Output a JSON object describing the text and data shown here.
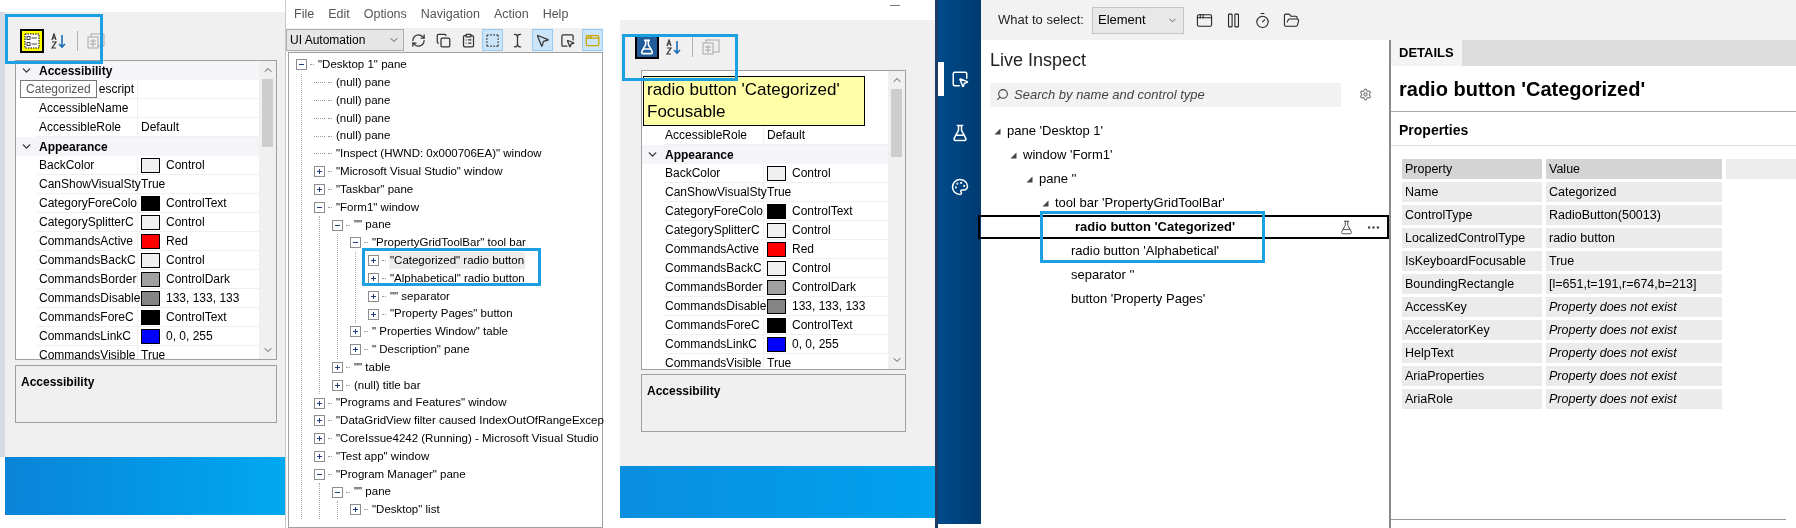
{
  "left_inspector": {
    "toolbar": [
      {
        "kind": "categorized",
        "selected": true,
        "disabled": false
      },
      {
        "kind": "alphabetical",
        "selected": false,
        "disabled": false
      },
      {
        "kind": "pages",
        "selected": false,
        "disabled": true
      }
    ],
    "grid": {
      "categories": [
        {
          "title": "Accessibility",
          "expanded": true,
          "rows": [
            {
              "name": "escript",
              "tooltip": "Categorized"
            },
            {
              "name": "AccessibleName"
            },
            {
              "name": "AccessibleRole",
              "value": "Default"
            }
          ]
        },
        {
          "title": "Appearance",
          "expanded": true,
          "rows": [
            {
              "name": "BackColor",
              "value": "Control",
              "color": "#f0f0f0"
            },
            {
              "name": "CanShowVisualSty",
              "value": "True"
            },
            {
              "name": "CategoryForeColo",
              "value": "ControlText",
              "color": "#000000"
            },
            {
              "name": "CategorySplitterC",
              "value": "Control",
              "color": "#f0f0f0"
            },
            {
              "name": "CommandsActive",
              "value": "Red",
              "color": "#ff0000"
            },
            {
              "name": "CommandsBackC",
              "value": "Control",
              "color": "#f0f0f0"
            },
            {
              "name": "CommandsBorder",
              "value": "ControlDark",
              "color": "#a0a0a0"
            },
            {
              "name": "CommandsDisable",
              "value": "133, 133, 133",
              "color": "#858585"
            },
            {
              "name": "CommandsForeC",
              "value": "ControlText",
              "color": "#000000"
            },
            {
              "name": "CommandsLinkC",
              "value": "0, 0, 255",
              "color": "#0000ff"
            },
            {
              "name": "CommandsVisible",
              "value": "True"
            }
          ]
        }
      ]
    },
    "description_title": "Accessibility"
  },
  "tree_window": {
    "menu": [
      "File",
      "Edit",
      "Options",
      "Navigation",
      "Action",
      "Help"
    ],
    "provider": "UI Automation",
    "toolbar": [
      {
        "kind": "refresh",
        "selected": false
      },
      {
        "kind": "copy",
        "selected": false
      },
      {
        "kind": "properties",
        "selected": false
      },
      {
        "kind": "rectangle",
        "selected": true
      },
      {
        "kind": "text",
        "selected": false
      },
      {
        "kind": "pointer",
        "selected": true
      },
      {
        "kind": "hover",
        "selected": false
      },
      {
        "kind": "highlight",
        "selected": true
      }
    ],
    "tree": [
      {
        "label": "\"Desktop 1\" pane",
        "expanded": true,
        "selected": false,
        "children": [
          {
            "label": "(null) pane",
            "selected": false
          },
          {
            "label": "(null) pane",
            "selected": false
          },
          {
            "label": "(null) pane",
            "selected": false
          },
          {
            "label": "(null) pane",
            "selected": false
          },
          {
            "label": "\"Inspect  (HWND: 0x000706EA)\" window",
            "selected": false
          },
          {
            "label": "\"Microsoft Visual Studio\" window",
            "expanded": false,
            "selected": false
          },
          {
            "label": "\"Taskbar\" pane",
            "expanded": false,
            "selected": false
          },
          {
            "label": "\"Form1\" window",
            "expanded": true,
            "selected": false,
            "children": [
              {
                "label": "\"\" pane",
                "expanded": true,
                "selected": false,
                "children": [
                  {
                    "label": "\"PropertyGridToolBar\" tool bar",
                    "expanded": true,
                    "selected": false,
                    "children": [
                      {
                        "label": "\"Categorized\" radio button",
                        "expanded": false,
                        "selected": true
                      },
                      {
                        "label": "\"Alphabetical\" radio button",
                        "expanded": false,
                        "selected": false
                      },
                      {
                        "label": "\"\" separator",
                        "expanded": false,
                        "selected": false
                      },
                      {
                        "label": "\"Property Pages\" button",
                        "expanded": false,
                        "selected": false
                      }
                    ]
                  },
                  {
                    "label": "\" Properties Window\" table",
                    "expanded": false,
                    "selected": false
                  },
                  {
                    "label": "\" Description\" pane",
                    "expanded": false,
                    "selected": false
                  }
                ]
              },
              {
                "label": "\"\" table",
                "expanded": false,
                "selected": false
              },
              {
                "label": "(null) title bar",
                "expanded": false,
                "selected": false
              }
            ]
          },
          {
            "label": "\"Programs and Features\" window",
            "expanded": false,
            "selected": false
          },
          {
            "label": "\"DataGridView filter caused IndexOutOfRangeExcep",
            "expanded": false,
            "selected": false
          },
          {
            "label": "\"CoreIssue4242 (Running) - Microsoft Visual Studio",
            "expanded": false,
            "selected": false
          },
          {
            "label": "\"Test app\" window",
            "expanded": false,
            "selected": false
          },
          {
            "label": "\"Program Manager\" pane",
            "expanded": true,
            "selected": false,
            "children": [
              {
                "label": "\"\" pane",
                "expanded": true,
                "selected": false,
                "children": [
                  {
                    "label": "\"Desktop\" list",
                    "expanded": false,
                    "selected": false
                  }
                ]
              }
            ]
          }
        ]
      }
    ]
  },
  "right_inspector": {
    "toolbar": [
      {
        "kind": "flask-marker",
        "selected": true,
        "disabled": false
      },
      {
        "kind": "alphabetical",
        "selected": false,
        "disabled": false
      },
      {
        "kind": "pages",
        "selected": false,
        "disabled": true
      }
    ],
    "tooltip": [
      "radio button 'Categorized'",
      "Focusable"
    ],
    "grid": {
      "categories": [
        {
          "rows": [
            {
              "name": "AccessibleRole",
              "value": "Default"
            }
          ]
        },
        {
          "title": "Appearance",
          "expanded": true,
          "rows": [
            {
              "name": "BackColor",
              "value": "Control",
              "color": "#f0f0f0"
            },
            {
              "name": "CanShowVisualSty",
              "value": "True"
            },
            {
              "name": "CategoryForeColo",
              "value": "ControlText",
              "color": "#000000"
            },
            {
              "name": "CategorySplitterC",
              "value": "Control",
              "color": "#f0f0f0"
            },
            {
              "name": "CommandsActive",
              "value": "Red",
              "color": "#ff0000"
            },
            {
              "name": "CommandsBackC",
              "value": "Control",
              "color": "#f0f0f0"
            },
            {
              "name": "CommandsBorder",
              "value": "ControlDark",
              "color": "#a0a0a0"
            },
            {
              "name": "CommandsDisable",
              "value": "133, 133, 133",
              "color": "#858585"
            },
            {
              "name": "CommandsForeC",
              "value": "ControlText",
              "color": "#000000"
            },
            {
              "name": "CommandsLinkC",
              "value": "0, 0, 255",
              "color": "#0000ff"
            },
            {
              "name": "CommandsVisible",
              "value": "True"
            }
          ]
        }
      ]
    },
    "description_title": "Accessibility"
  },
  "insights": {
    "nav": [
      {
        "kind": "inspect",
        "selected": true
      },
      {
        "kind": "test",
        "selected": false
      },
      {
        "kind": "color",
        "selected": false
      }
    ],
    "select_label": "What to select:",
    "select_value": "Element",
    "tools": [
      {
        "kind": "window"
      },
      {
        "kind": "pause"
      },
      {
        "kind": "timer"
      },
      {
        "kind": "folder"
      }
    ],
    "live_title": "Live Inspect",
    "search": {
      "placeholder": "Search by name and control type"
    },
    "tree": [
      {
        "label": "pane 'Desktop 1'",
        "expanded": true,
        "selected": false,
        "children": [
          {
            "label": "window 'Form1'",
            "expanded": true,
            "selected": false,
            "children": [
              {
                "label": "pane ''",
                "expanded": true,
                "selected": false,
                "children": [
                  {
                    "label": "tool bar 'PropertyGridToolBar'",
                    "expanded": true,
                    "selected": false,
                    "children": [
                      {
                        "label": "radio button 'Categorized'",
                        "selected": true
                      },
                      {
                        "label": "radio button 'Alphabetical'",
                        "selected": false
                      },
                      {
                        "label": "separator ''",
                        "selected": false
                      },
                      {
                        "label": "button 'Property Pages'",
                        "selected": false
                      }
                    ]
                  }
                ]
              }
            ]
          }
        ]
      }
    ],
    "details_tab": "DETAILS",
    "details_title": "radio button 'Categorized'",
    "properties_title": "Properties",
    "table": {
      "columns": [
        "Property",
        "Value"
      ],
      "rows": [
        {
          "name": "Name",
          "value": "Categorized",
          "kind": "value"
        },
        {
          "name": "ControlType",
          "value": "RadioButton(50013)",
          "kind": "value"
        },
        {
          "name": "LocalizedControlType",
          "value": "radio button",
          "kind": "value"
        },
        {
          "name": "IsKeyboardFocusable",
          "value": "True",
          "kind": "value"
        },
        {
          "name": "BoundingRectangle",
          "value": "[l=651,t=191,r=674,b=213]",
          "kind": "value"
        },
        {
          "name": "AccessKey",
          "value": "Property does not exist",
          "kind": "missing"
        },
        {
          "name": "AcceleratorKey",
          "value": "Property does not exist",
          "kind": "missing"
        },
        {
          "name": "HelpText",
          "value": "Property does not exist",
          "kind": "missing"
        },
        {
          "name": "AriaProperties",
          "value": "Property does not exist",
          "kind": "missing"
        },
        {
          "name": "AriaRole",
          "value": "Property does not exist",
          "kind": "missing"
        }
      ]
    }
  }
}
